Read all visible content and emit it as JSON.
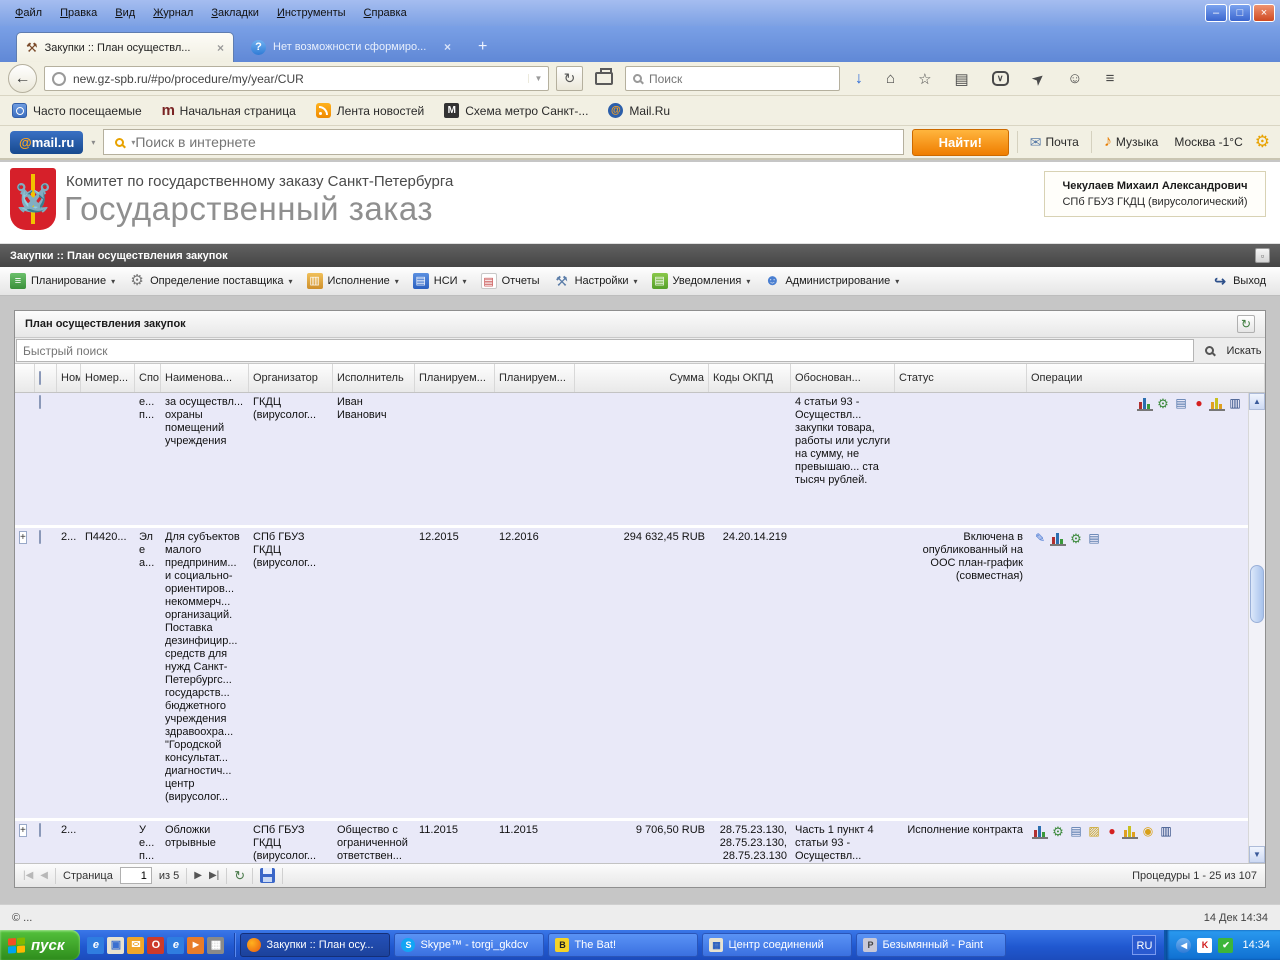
{
  "icons": {
    "back": "←",
    "url_caret": "▼",
    "reload": "↻",
    "download": "↓",
    "home": "⌂",
    "star": "☆",
    "clipboard": "▤",
    "pocket": "∨",
    "send": "➤",
    "chat": "☺",
    "menu": "≡",
    "plus": "+",
    "tab_close": "×",
    "hammer": "⚒",
    "question": "?",
    "minimize": "–",
    "maximize": "□",
    "win_close": "×",
    "m_home": "m",
    "metro": "M",
    "mail_at": "@",
    "envelope": "✉",
    "music": "♪",
    "gear": "⚙",
    "caret": "▾",
    "plan": "≡",
    "supplier": "⚙",
    "execution": "▥",
    "nsi": "▤",
    "reports": "▤",
    "settings": "⚒",
    "notifications": "▤",
    "admin": "☻",
    "exit": "↪",
    "collapse": "▫",
    "refresh_panel": "↻",
    "expand": "+",
    "scroll_up": "▲",
    "scroll_down": "▼",
    "pencil": "✎",
    "gears": "⚙",
    "list": "▤",
    "note": "▨",
    "stop": "●",
    "coins": "◉",
    "books": "▥",
    "first": "|◀",
    "prev": "◀",
    "next": "▶",
    "last": "▶|",
    "refresh": "↻",
    "ql": [
      "e",
      "▣",
      "✉",
      "O",
      "e",
      "►",
      "▦"
    ],
    "task": [
      "",
      "S",
      "B",
      "▦",
      "P"
    ],
    "tray_chevron": "◀",
    "kaspersky": "K",
    "antivirus_ok": "✔"
  },
  "browser": {
    "menu": [
      "Файл",
      "Правка",
      "Вид",
      "Журнал",
      "Закладки",
      "Инструменты",
      "Справка"
    ],
    "tabs": [
      {
        "title": "Закупки :: План осуществл..."
      },
      {
        "title": "Нет возможности сформиро..."
      }
    ],
    "url": "new.gz-spb.ru/#po/procedure/my/year/CUR",
    "search_placeholder": "Поиск",
    "bookmarks": [
      "Часто посещаемые",
      "Начальная страница",
      "Лента новостей",
      "Схема метро Санкт-...",
      "Mail.Ru"
    ]
  },
  "mailru": {
    "logo_at": "@",
    "logo_text": "mail.ru",
    "search_placeholder": "Поиск в интернете",
    "find_button": "Найти!",
    "mail": "Почта",
    "music": "Музыка",
    "weather": "Москва -1°C"
  },
  "site": {
    "org_line1": "Комитет по государственному заказу Санкт-Петербурга",
    "org_line2": "Государственный заказ",
    "user_name": "Чекулаев Михаил Александрович",
    "user_org": "СПб ГБУЗ ГКДЦ (вирусологический)",
    "breadcrumb": "Закупки :: План осуществления закупок",
    "menu": [
      {
        "label": "Планирование"
      },
      {
        "label": "Определение поставщика"
      },
      {
        "label": "Исполнение"
      },
      {
        "label": "НСИ"
      },
      {
        "label": "Отчеты"
      },
      {
        "label": "Настройки"
      },
      {
        "label": "Уведомления"
      },
      {
        "label": "Администрирование"
      }
    ],
    "exit_label": "Выход",
    "panel_title": "План осуществления закупок",
    "quick_search_placeholder": "Быстрый поиск",
    "search_button": "Искать"
  },
  "table": {
    "headers": [
      "Ном",
      "Номер...",
      "Спо...",
      "Наименова...",
      "Организатор",
      "Исполнитель",
      "Планируем...",
      "Планируем...",
      "Сумма",
      "Коды ОКПД",
      "Обоснован...",
      "Статус",
      "Операции"
    ],
    "rows": [
      {
        "num": "",
        "number": "",
        "method": "е... п...",
        "name": "за осуществл... охраны помещений учреждения",
        "organizer": "ГКДЦ (вирусолог...",
        "executor": "Иван Иванович",
        "plan1": "",
        "plan2": "",
        "sum": "",
        "okpd": "",
        "justification": "4 статьи 93 - Осуществл... закупки товара, работы или услуги на сумму, не превышаю... ста тысяч рублей.",
        "status": "",
        "ops": [
          "chart",
          "gears",
          "list",
          "stop",
          "stats",
          "books"
        ]
      },
      {
        "num": "2...",
        "number": "П4420...",
        "method": "Эле а...",
        "name": "Для субъектов малого предприним... и социально-ориентиров... некоммерч... организаций. Поставка дезинфицир... средств для нужд Санкт-Петербургс... государств... бюджетного учреждения здравоохра... \"Городской консультат... диагностич... центр (вирусолог...",
        "organizer": "СПб ГБУЗ ГКДЦ (вирусолог...",
        "executor": "",
        "plan1": "12.2015",
        "plan2": "12.2016",
        "sum": "294 632,45 RUB",
        "okpd": "24.20.14.219",
        "justification": "",
        "status": "Включена в опубликованный на ООС план-график (совместная)",
        "ops": [
          "pencil",
          "chart",
          "gears",
          "list"
        ]
      },
      {
        "num": "2...",
        "number": "",
        "method": "У е... п...",
        "name": "Обложки отрывные",
        "organizer": "СПб ГБУЗ ГКДЦ (вирусолог...",
        "executor": "Общество с ограниченной ответствен...",
        "plan1": "11.2015",
        "plan2": "11.2015",
        "sum": "9 706,50 RUB",
        "okpd": "28.75.23.130, 28.75.23.130, 28.75.23.130",
        "justification": "Часть 1 пункт 4 статьи 93 - Осуществл...",
        "status": "Исполнение контракта",
        "ops": [
          "chart",
          "gears",
          "list",
          "note",
          "stop",
          "stats",
          "coins",
          "books"
        ]
      }
    ]
  },
  "pagination": {
    "page_label": "Страница",
    "page_value": "1",
    "total_label": "из 5",
    "records_info": "Процедуры 1 - 25 из 107"
  },
  "statusbar": {
    "left": "© ...",
    "datetime": "14 Дек 14:34"
  },
  "taskbar": {
    "start": "пуск",
    "tasks": [
      "Закупки :: План осу...",
      "Skype™ - torgi_gkdcv",
      "The Bat!",
      "Центр соединений",
      "Безымянный - Paint"
    ],
    "lang": "RU",
    "time": "14:34"
  }
}
